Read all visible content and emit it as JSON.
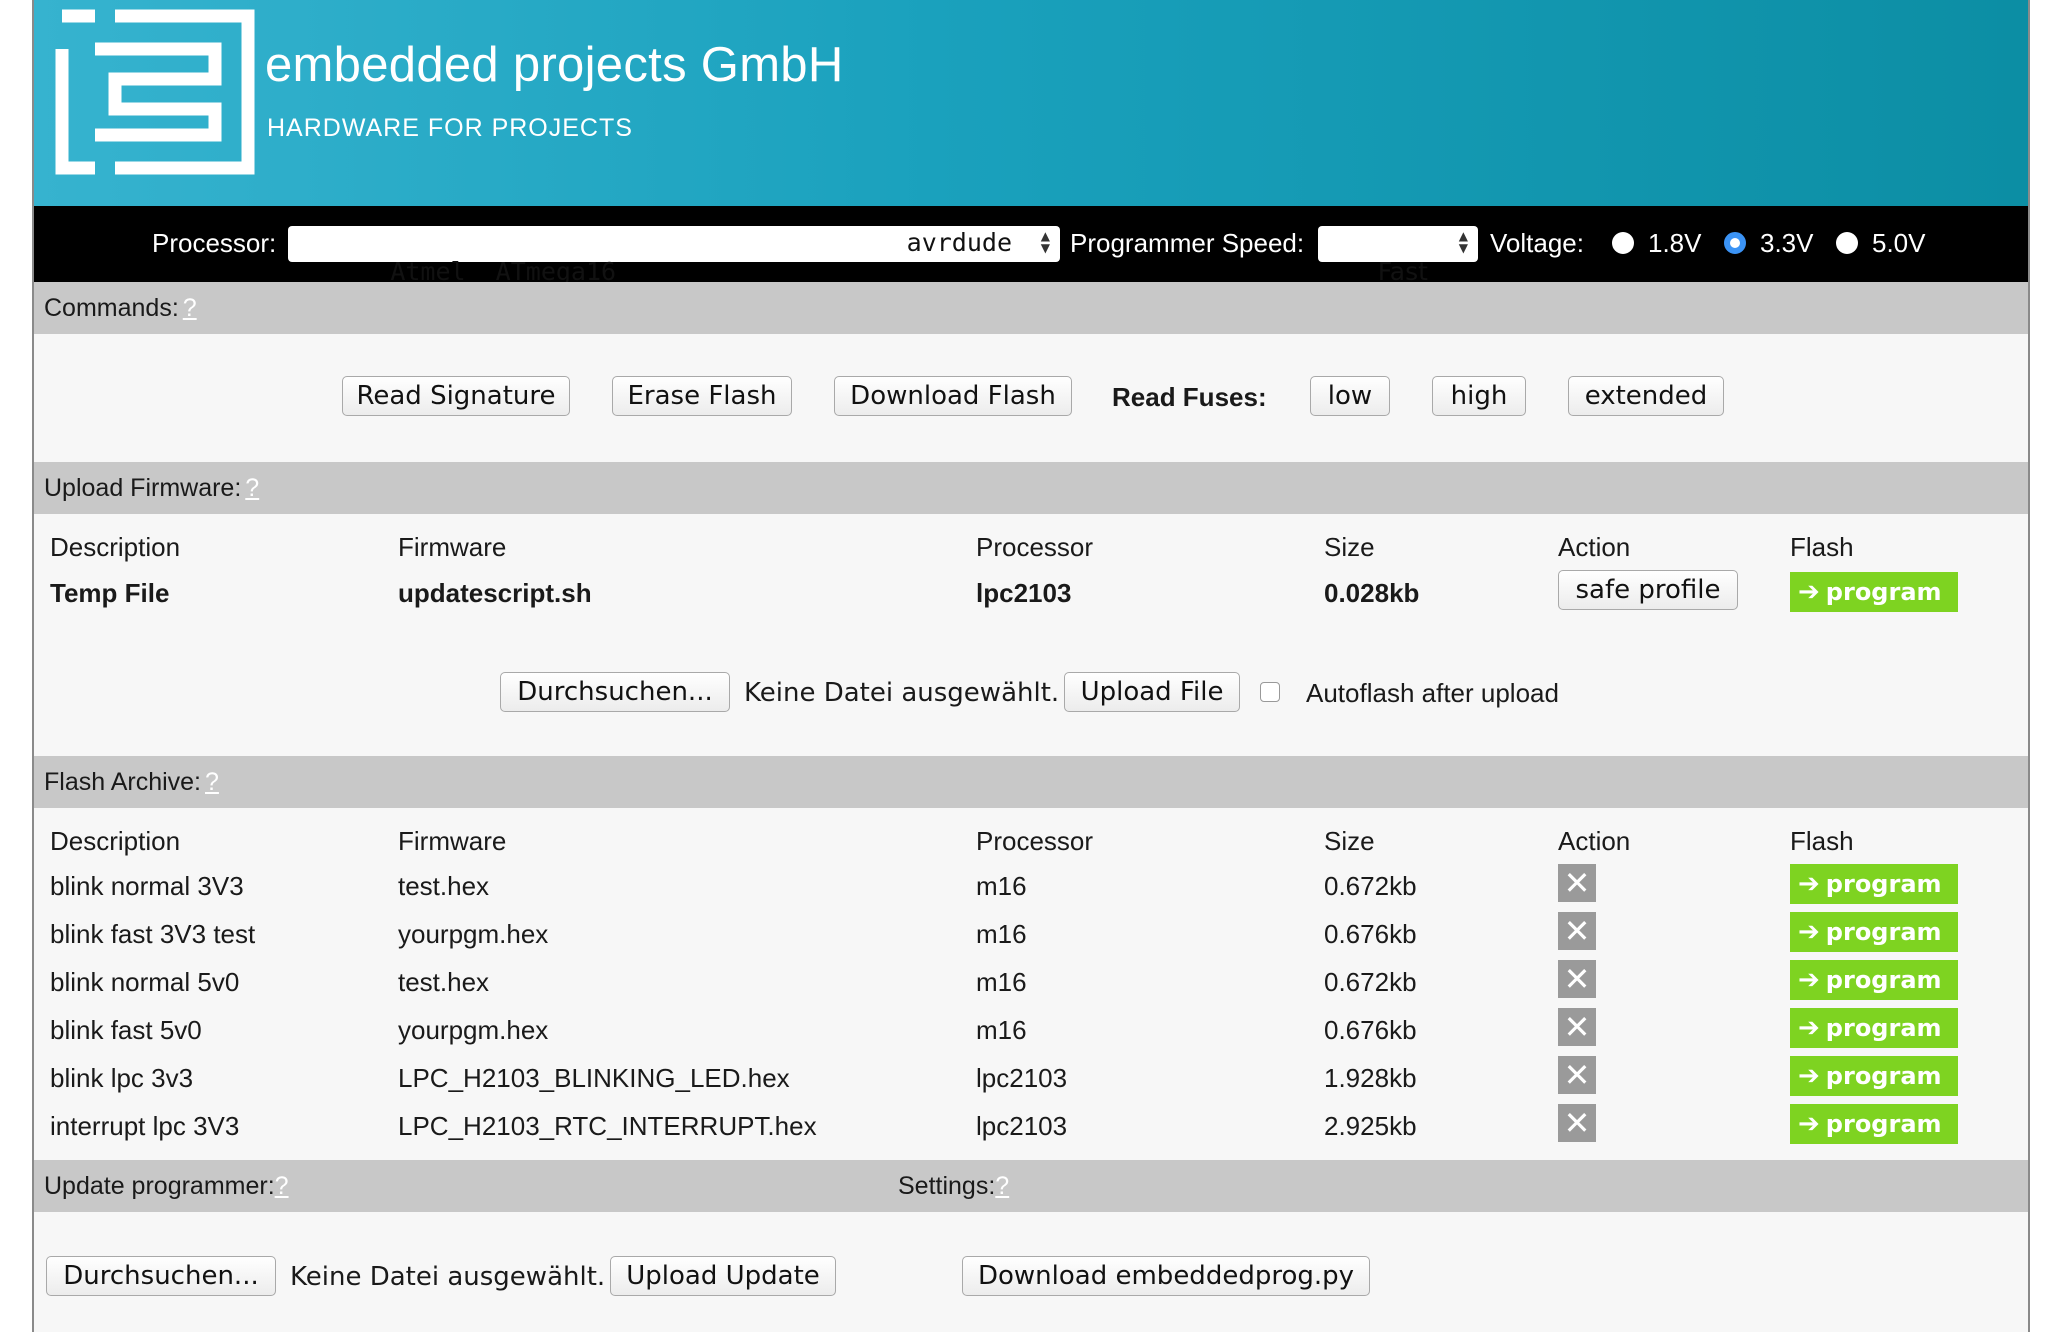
{
  "brand": {
    "name": "embedded projects GmbH",
    "tagline": "HARDWARE FOR PROJECTS",
    "logo_icon": "ep-logo-icon",
    "header_color": "#1aa1bd"
  },
  "toolbar": {
    "processor_label": "Processor:",
    "processor_value": "Atmel  ATmega16",
    "processor_tool": "avrdude",
    "speed_label": "Programmer Speed:",
    "speed_value": "Fast",
    "voltage_label": "Voltage:",
    "voltages": [
      {
        "label": "1.8V",
        "checked": false
      },
      {
        "label": "3.3V",
        "checked": true
      },
      {
        "label": "5.0V",
        "checked": false
      }
    ]
  },
  "commands": {
    "title": "Commands:",
    "help": "?",
    "read_signature": "Read Signature",
    "erase_flash": "Erase Flash",
    "download_flash": "Download Flash",
    "read_fuses_label": "Read Fuses:",
    "fuse_low": "low",
    "fuse_high": "high",
    "fuse_extended": "extended"
  },
  "upload": {
    "title": "Upload Firmware:",
    "help": "?",
    "headers": {
      "description": "Description",
      "firmware": "Firmware",
      "processor": "Processor",
      "size": "Size",
      "action": "Action",
      "flash": "Flash"
    },
    "row": {
      "description": "Temp File",
      "firmware": "updatescript.sh",
      "processor": "lpc2103",
      "size": "0.028kb",
      "action": "safe profile",
      "flash": "program"
    },
    "browse": "Durchsuchen...",
    "no_file": "Keine Datei ausgewählt.",
    "upload_file": "Upload File",
    "autoflash": "Autoflash after upload"
  },
  "archive": {
    "title": "Flash Archive:",
    "help": "?",
    "headers": {
      "description": "Description",
      "firmware": "Firmware",
      "processor": "Processor",
      "size": "Size",
      "action": "Action",
      "flash": "Flash"
    },
    "rows": [
      {
        "description": "blink normal 3V3",
        "firmware": "test.hex",
        "processor": "m16",
        "size": "0.672kb",
        "flash": "program"
      },
      {
        "description": "blink fast 3V3 test",
        "firmware": "yourpgm.hex",
        "processor": "m16",
        "size": "0.676kb",
        "flash": "program"
      },
      {
        "description": "blink normal 5v0",
        "firmware": "test.hex",
        "processor": "m16",
        "size": "0.672kb",
        "flash": "program"
      },
      {
        "description": "blink fast 5v0",
        "firmware": "yourpgm.hex",
        "processor": "m16",
        "size": "0.676kb",
        "flash": "program"
      },
      {
        "description": "blink lpc 3v3",
        "firmware": "LPC_H2103_BLINKING_LED.hex",
        "processor": "lpc2103",
        "size": "1.928kb",
        "flash": "program"
      },
      {
        "description": "interrupt lpc 3V3",
        "firmware": "LPC_H2103_RTC_INTERRUPT.hex",
        "processor": "lpc2103",
        "size": "2.925kb",
        "flash": "program"
      }
    ]
  },
  "update": {
    "title": "Update programmer:",
    "help": "?",
    "browse": "Durchsuchen...",
    "no_file": "Keine Datei ausgewählt.",
    "upload_update": "Upload Update"
  },
  "settings": {
    "title": "Settings:",
    "help": "?",
    "download": "Download embeddedprog.py"
  },
  "colors": {
    "program_green": "#7ed321",
    "section_gray": "#c8c8c8",
    "radio_blue": "#3b93f5"
  }
}
